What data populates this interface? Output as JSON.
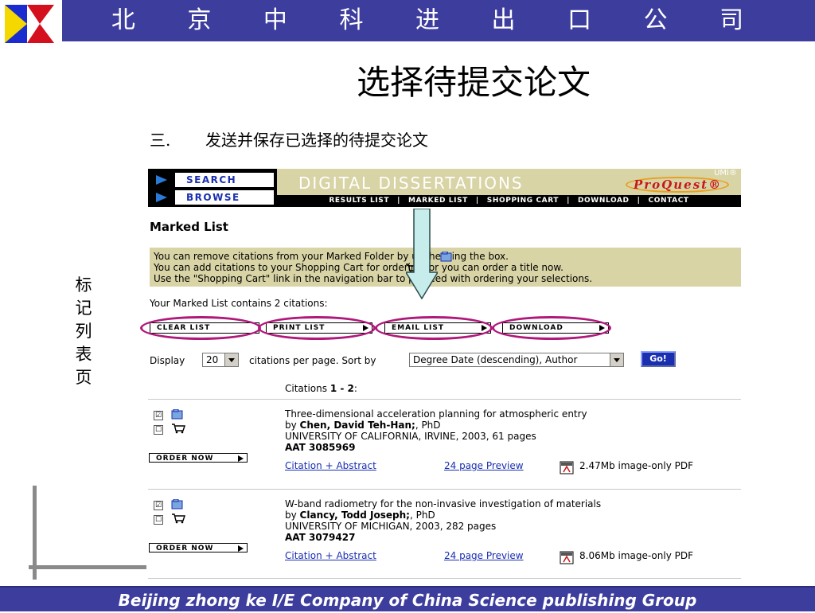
{
  "header": {
    "company_name": "北 京 中 科 进 出 口 公 司",
    "slide_title": "选择待提交论文",
    "subtitle_number": "三.",
    "subtitle_text": "发送并保存已选择的待提交论文",
    "side_label": [
      "标",
      "记",
      "列",
      "表",
      "页"
    ]
  },
  "proquest": {
    "nav": {
      "search": "SEARCH",
      "browse": "BROWSE"
    },
    "title": "DIGITAL DISSERTATIONS",
    "logo_umi": "UMI®",
    "logo_text": "ProQuest®",
    "tabs": [
      "RESULTS LIST",
      "|",
      "MARKED LIST",
      "|",
      "SHOPPING CART",
      "|",
      "DOWNLOAD",
      "|",
      "CONTACT"
    ]
  },
  "page": {
    "heading": "Marked List",
    "notice": [
      "You can remove citations from your Marked Folder      by unchecking the box.",
      "You can add citations to your Shopping Cart      for ordering, or you can order a title now.",
      "Use the \"Shopping Cart\" link in the navigation bar to proceed with ordering your selections."
    ],
    "count_text": "Your Marked List contains 2 citations:",
    "actions": {
      "clear": "CLEAR LIST",
      "print": "PRINT LIST",
      "email": "EMAIL LIST",
      "download": "DOWNLOAD"
    },
    "display_label": "Display",
    "per_page_value": "20",
    "per_page_text": "citations per page. Sort by",
    "sort_value": "Degree Date (descending), Author",
    "go_label": "Go!",
    "citations_prefix": "Citations ",
    "citations_range": "1 - 2",
    "citations_suffix": ":"
  },
  "results": [
    {
      "title": "Three-dimensional acceleration planning for atmospheric entry",
      "by": "by ",
      "author": "Chen, David Teh-Han;",
      "degree": ", PhD",
      "institution": "UNIVERSITY OF CALIFORNIA, IRVINE, 2003, 61 pages",
      "aat": "AAT 3085969",
      "order_label": "ORDER NOW",
      "citation_link": "Citation + Abstract",
      "preview_link": "24 page Preview",
      "pdf_text": "2.47Mb image-only PDF",
      "marked": "☑",
      "in_cart": "☐"
    },
    {
      "title": "W-band radiometry for the non-invasive investigation of materials",
      "by": "by ",
      "author": "Clancy, Todd Joseph;",
      "degree": ", PhD",
      "institution": "UNIVERSITY OF MICHIGAN, 2003, 282 pages",
      "aat": "AAT 3079427",
      "order_label": "ORDER NOW",
      "citation_link": "Citation + Abstract",
      "preview_link": "24 page Preview",
      "pdf_text": "8.06Mb image-only PDF",
      "marked": "☑",
      "in_cart": "☐"
    }
  ],
  "footer": {
    "text": "Beijing  zhong ke I/E Company of China Science publishing Group"
  },
  "colors": {
    "banner": "#3d3d9e",
    "proquest_tan": "#d8d4a6",
    "oval_highlight": "#b0187a",
    "link_blue": "#1a2fb0"
  }
}
